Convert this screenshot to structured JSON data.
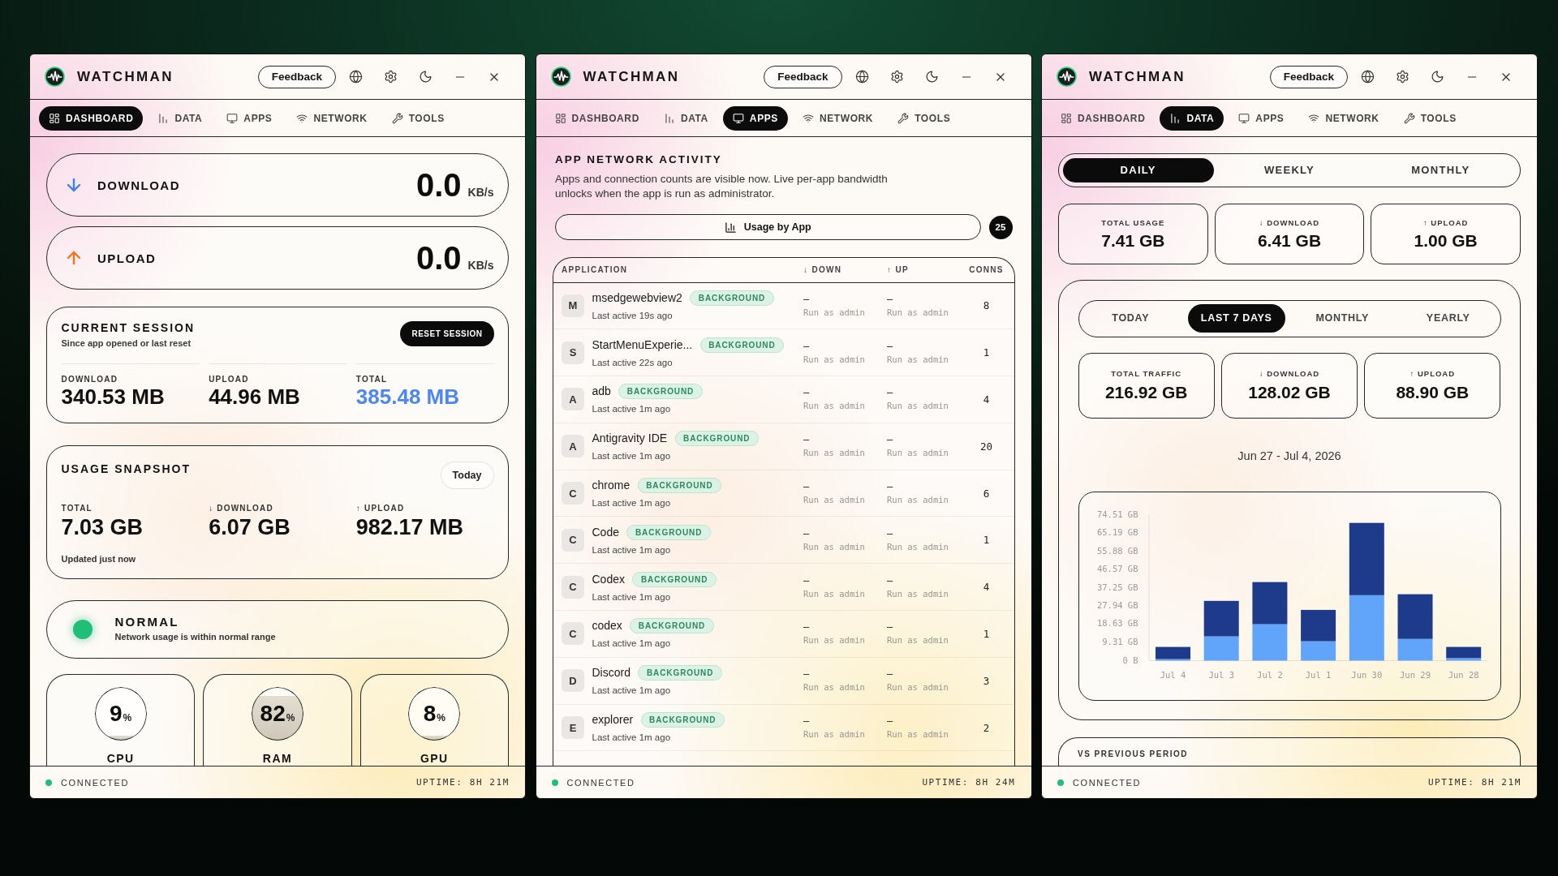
{
  "windows": [
    {
      "app_name": "WATCHMAN",
      "feedback": "Feedback",
      "tabs": [
        {
          "label": "DASHBOARD",
          "selected": true
        },
        {
          "label": "DATA",
          "selected": false
        },
        {
          "label": "APPS",
          "selected": false
        },
        {
          "label": "NETWORK",
          "selected": false
        },
        {
          "label": "TOOLS",
          "selected": false
        }
      ],
      "view": {
        "kind": "dashboard",
        "speeds": [
          {
            "kind": "download",
            "label": "DOWNLOAD",
            "value": "0.0",
            "unit": "KB/s"
          },
          {
            "kind": "upload",
            "label": "UPLOAD",
            "value": "0.0",
            "unit": "KB/s"
          }
        ],
        "session": {
          "title": "CURRENT SESSION",
          "subtitle": "Since app opened or last reset",
          "button": "RESET SESSION",
          "stats": [
            {
              "label": "DOWNLOAD",
              "value": "340.53 MB",
              "highlight": false
            },
            {
              "label": "UPLOAD",
              "value": "44.96 MB",
              "highlight": false
            },
            {
              "label": "TOTAL",
              "value": "385.48 MB",
              "highlight": true
            }
          ]
        },
        "snapshot": {
          "title": "USAGE SNAPSHOT",
          "period": "Today",
          "stats": [
            {
              "label": "TOTAL",
              "value": "7.03 GB"
            },
            {
              "label": "↓ DOWNLOAD",
              "value": "6.07 GB"
            },
            {
              "label": "↑ UPLOAD",
              "value": "982.17 MB"
            }
          ],
          "updated": "Updated just now"
        },
        "health": {
          "kind": "normal",
          "title": "NORMAL",
          "description": "Network usage is within normal range"
        },
        "resources": [
          {
            "label": "CPU",
            "value": "9",
            "unit": "%",
            "level": 0.09
          },
          {
            "label": "RAM",
            "value": "82",
            "unit": "%",
            "level": 0.82
          },
          {
            "label": "GPU",
            "value": "8",
            "unit": "%",
            "level": 0.08
          }
        ]
      },
      "status_bar": {
        "connected": true,
        "label": "CONNECTED",
        "uptime": "UPTIME: 8H 21M"
      }
    },
    {
      "app_name": "WATCHMAN",
      "feedback": "Feedback",
      "tabs": [
        {
          "label": "DASHBOARD",
          "selected": false
        },
        {
          "label": "DATA",
          "selected": false
        },
        {
          "label": "APPS",
          "selected": true
        },
        {
          "label": "NETWORK",
          "selected": false
        },
        {
          "label": "TOOLS",
          "selected": false
        }
      ],
      "view": {
        "kind": "apps",
        "title": "APP NETWORK ACTIVITY",
        "description": "Apps and connection counts are visible now. Live per-app bandwidth unlocks when the app is run as administrator.",
        "usage_button": "Usage by App",
        "count": "25",
        "columns": [
          "APPLICATION",
          "↓ DOWN",
          "↑ UP",
          "CONNS"
        ],
        "rows": [
          {
            "initial": "M",
            "name": "msedgewebview2",
            "tag": "BACKGROUND",
            "last_active": "Last active 19s ago",
            "down": "–",
            "down_note": "Run as admin",
            "up": "–",
            "up_note": "Run as admin",
            "conns": "8"
          },
          {
            "initial": "S",
            "name": "StartMenuExperie...",
            "tag": "BACKGROUND",
            "last_active": "Last active 22s ago",
            "down": "–",
            "down_note": "Run as admin",
            "up": "–",
            "up_note": "Run as admin",
            "conns": "1"
          },
          {
            "initial": "A",
            "name": "adb",
            "tag": "BACKGROUND",
            "last_active": "Last active 1m ago",
            "down": "–",
            "down_note": "Run as admin",
            "up": "–",
            "up_note": "Run as admin",
            "conns": "4"
          },
          {
            "initial": "A",
            "name": "Antigravity IDE",
            "tag": "BACKGROUND",
            "last_active": "Last active 1m ago",
            "down": "–",
            "down_note": "Run as admin",
            "up": "–",
            "up_note": "Run as admin",
            "conns": "20"
          },
          {
            "initial": "C",
            "name": "chrome",
            "tag": "BACKGROUND",
            "last_active": "Last active 1m ago",
            "down": "–",
            "down_note": "Run as admin",
            "up": "–",
            "up_note": "Run as admin",
            "conns": "6"
          },
          {
            "initial": "C",
            "name": "Code",
            "tag": "BACKGROUND",
            "last_active": "Last active 1m ago",
            "down": "–",
            "down_note": "Run as admin",
            "up": "–",
            "up_note": "Run as admin",
            "conns": "1"
          },
          {
            "initial": "C",
            "name": "Codex",
            "tag": "BACKGROUND",
            "last_active": "Last active 1m ago",
            "down": "–",
            "down_note": "Run as admin",
            "up": "–",
            "up_note": "Run as admin",
            "conns": "4"
          },
          {
            "initial": "C",
            "name": "codex",
            "tag": "BACKGROUND",
            "last_active": "Last active 1m ago",
            "down": "–",
            "down_note": "Run as admin",
            "up": "–",
            "up_note": "Run as admin",
            "conns": "1"
          },
          {
            "initial": "D",
            "name": "Discord",
            "tag": "BACKGROUND",
            "last_active": "Last active 1m ago",
            "down": "–",
            "down_note": "Run as admin",
            "up": "–",
            "up_note": "Run as admin",
            "conns": "3"
          },
          {
            "initial": "E",
            "name": "explorer",
            "tag": "BACKGROUND",
            "last_active": "Last active 1m ago",
            "down": "–",
            "down_note": "Run as admin",
            "up": "–",
            "up_note": "Run as admin",
            "conns": "2"
          }
        ]
      },
      "status_bar": {
        "connected": true,
        "label": "CONNECTED",
        "uptime": "UPTIME: 8H 24M"
      }
    },
    {
      "app_name": "WATCHMAN",
      "feedback": "Feedback",
      "tabs": [
        {
          "label": "DASHBOARD",
          "selected": false
        },
        {
          "label": "DATA",
          "selected": true
        },
        {
          "label": "APPS",
          "selected": false
        },
        {
          "label": "NETWORK",
          "selected": false
        },
        {
          "label": "TOOLS",
          "selected": false
        }
      ],
      "view": {
        "kind": "data",
        "periods": [
          {
            "label": "DAILY",
            "selected": true
          },
          {
            "label": "WEEKLY",
            "selected": false
          },
          {
            "label": "MONTHLY",
            "selected": false
          }
        ],
        "summary": [
          {
            "label": "TOTAL USAGE",
            "value": "7.41 GB"
          },
          {
            "label": "↓ DOWNLOAD",
            "value": "6.41 GB"
          },
          {
            "label": "↑ UPLOAD",
            "value": "1.00 GB"
          }
        ],
        "ranges": [
          {
            "label": "TODAY",
            "selected": false
          },
          {
            "label": "LAST 7 DAYS",
            "selected": true
          },
          {
            "label": "MONTHLY",
            "selected": false
          },
          {
            "label": "YEARLY",
            "selected": false
          }
        ],
        "range_stats": [
          {
            "label": "TOTAL TRAFFIC",
            "value": "216.92 GB"
          },
          {
            "label": "↓ DOWNLOAD",
            "value": "128.02 GB"
          },
          {
            "label": "↑ UPLOAD",
            "value": "88.90 GB"
          }
        ],
        "date_range": "Jun 27 - Jul 4, 2026",
        "chart_data": {
          "type": "bar",
          "stacked": true,
          "categories": [
            "Jul 4",
            "Jul 3",
            "Jul 2",
            "Jul 1",
            "Jun 30",
            "Jun 29",
            "Jun 28"
          ],
          "series": [
            {
              "color": "#60a5fa",
              "values": [
                0.8,
                12.4,
                18.6,
                9.9,
                33.4,
                11.1,
                1.3
              ]
            },
            {
              "color": "#1e3a8a",
              "values": [
                6.2,
                18.1,
                21.5,
                16.0,
                36.9,
                22.8,
                5.7
              ]
            }
          ],
          "ylim": [
            0,
            74.51
          ],
          "yticks": [
            {
              "value": 0,
              "label": "0 B"
            },
            {
              "value": 9.31,
              "label": "9.31 GB"
            },
            {
              "value": 18.63,
              "label": "18.63 GB"
            },
            {
              "value": 27.94,
              "label": "27.94 GB"
            },
            {
              "value": 37.25,
              "label": "37.25 GB"
            },
            {
              "value": 46.57,
              "label": "46.57 GB"
            },
            {
              "value": 55.88,
              "label": "55.88 GB"
            },
            {
              "value": 65.19,
              "label": "65.19 GB"
            },
            {
              "value": 74.51,
              "label": "74.51 GB"
            }
          ]
        },
        "comparison": {
          "title": "VS PREVIOUS PERIOD"
        }
      },
      "status_bar": {
        "connected": true,
        "label": "CONNECTED",
        "uptime": "UPTIME: 8H 21M"
      }
    }
  ]
}
